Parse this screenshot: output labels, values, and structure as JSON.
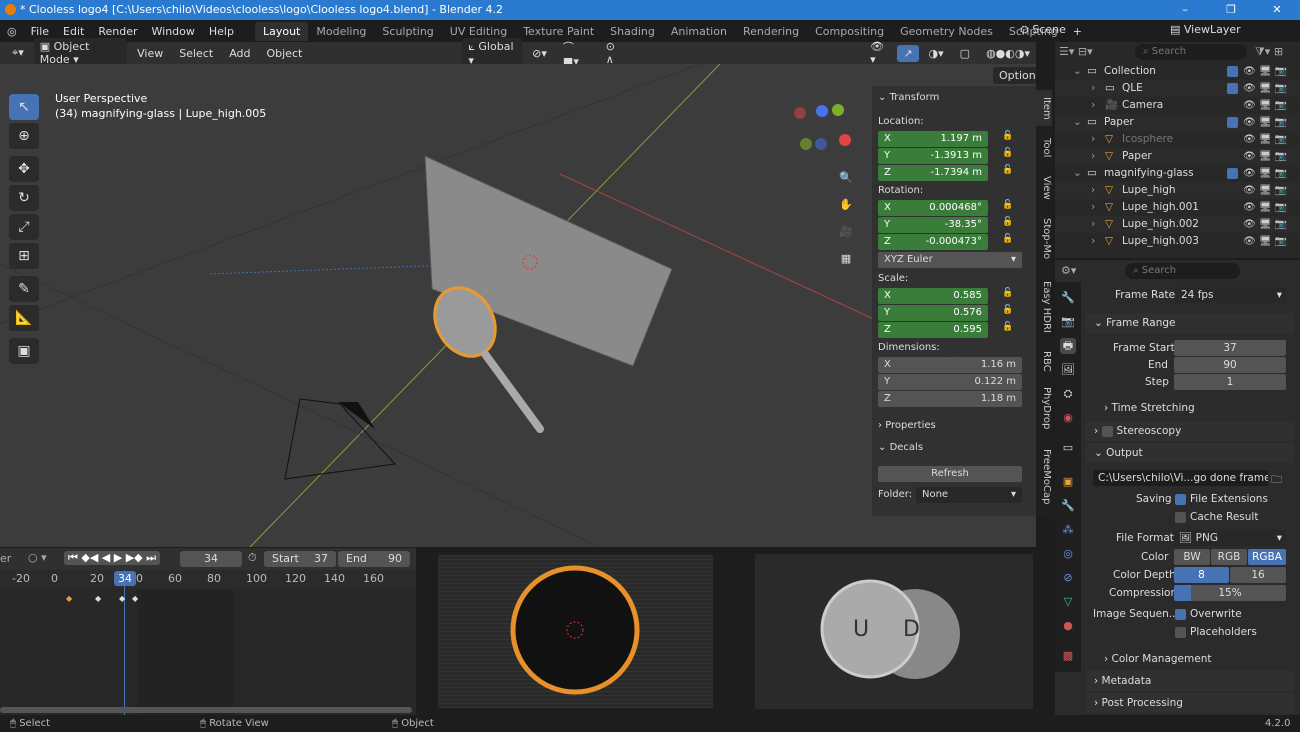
{
  "window": {
    "title": "* Clooless logo4 [C:\\Users\\chilo\\Videos\\clooless\\logo\\Clooless logo4.blend] - Blender 4.2"
  },
  "menu": [
    "File",
    "Edit",
    "Render",
    "Window",
    "Help"
  ],
  "workspaces": [
    "Layout",
    "Modeling",
    "Sculpting",
    "UV Editing",
    "Texture Paint",
    "Shading",
    "Animation",
    "Rendering",
    "Compositing",
    "Geometry Nodes",
    "Scripting"
  ],
  "scene": "Scene",
  "view_layer": "ViewLayer",
  "viewport_header": {
    "mode": "Object Mode",
    "menus": [
      "View",
      "Select",
      "Add",
      "Object"
    ],
    "orientation": "Global",
    "options": "Options"
  },
  "viewport": {
    "perspective": "User Perspective",
    "object_info": "(34) magnifying-glass | Lupe_high.005"
  },
  "npanel": {
    "transform": "Transform",
    "location_label": "Location:",
    "location": [
      {
        "axis": "X",
        "value": "1.197 m"
      },
      {
        "axis": "Y",
        "value": "-1.3913 m"
      },
      {
        "axis": "Z",
        "value": "-1.7394 m"
      }
    ],
    "rotation_label": "Rotation:",
    "rotation": [
      {
        "axis": "X",
        "value": "0.000468°"
      },
      {
        "axis": "Y",
        "value": "-38.35°"
      },
      {
        "axis": "Z",
        "value": "-0.000473°"
      }
    ],
    "rotation_mode": "XYZ Euler",
    "scale_label": "Scale:",
    "scale": [
      {
        "axis": "X",
        "value": "0.585"
      },
      {
        "axis": "Y",
        "value": "0.576"
      },
      {
        "axis": "Z",
        "value": "0.595"
      }
    ],
    "dimensions_label": "Dimensions:",
    "dimensions": [
      {
        "axis": "X",
        "value": "1.16 m"
      },
      {
        "axis": "Y",
        "value": "0.122 m"
      },
      {
        "axis": "Z",
        "value": "1.18 m"
      }
    ],
    "properties": "Properties",
    "decals": "Decals",
    "refresh": "Refresh",
    "folder_label": "Folder:",
    "folder": "None",
    "tabs": [
      "Item",
      "Tool",
      "View",
      "Stop-Mo",
      "Easy HDRI",
      "RBC",
      "PhyDrop",
      "FreeMoCap"
    ]
  },
  "outliner": {
    "search_placeholder": "Search",
    "rows": [
      {
        "name": "Collection",
        "indent": 0,
        "kind": "collection"
      },
      {
        "name": "QLE",
        "indent": 1,
        "kind": "collection"
      },
      {
        "name": "Camera",
        "indent": 1,
        "kind": "camera"
      },
      {
        "name": "Paper",
        "indent": 0,
        "kind": "collection"
      },
      {
        "name": "Icosphere",
        "indent": 1,
        "kind": "mesh",
        "dim": true
      },
      {
        "name": "Paper",
        "indent": 1,
        "kind": "mesh"
      },
      {
        "name": "magnifying-glass",
        "indent": 0,
        "kind": "collection"
      },
      {
        "name": "Lupe_high",
        "indent": 1,
        "kind": "mesh"
      },
      {
        "name": "Lupe_high.001",
        "indent": 1,
        "kind": "mesh"
      },
      {
        "name": "Lupe_high.002",
        "indent": 1,
        "kind": "mesh"
      },
      {
        "name": "Lupe_high.003",
        "indent": 1,
        "kind": "mesh"
      }
    ]
  },
  "properties": {
    "search_placeholder": "Search",
    "frame_rate_label": "Frame Rate",
    "frame_rate": "24 fps",
    "frame_range": "Frame Range",
    "frame_start_label": "Frame Start",
    "frame_start": "37",
    "end_label": "End",
    "end": "90",
    "step_label": "Step",
    "step": "1",
    "time_stretching": "Time Stretching",
    "stereoscopy": "Stereoscopy",
    "output": "Output",
    "output_path": "C:\\Users\\chilo\\Vi...go done frames 2\\",
    "saving_label": "Saving",
    "file_extensions": "File Extensions",
    "cache_result": "Cache Result",
    "file_format_label": "File Format",
    "file_format": "PNG",
    "color_label": "Color",
    "color_options": [
      "BW",
      "RGB",
      "RGBA"
    ],
    "color_selected": "RGBA",
    "color_depth_label": "Color Depth",
    "color_depth_options": [
      "8",
      "16"
    ],
    "color_depth_selected": "8",
    "compression_label": "Compression",
    "compression": "15%",
    "compression_value": 15,
    "image_sequence_label": "Image Sequen...",
    "overwrite": "Overwrite",
    "placeholders": "Placeholders",
    "color_management": "Color Management",
    "metadata": "Metadata",
    "post_processing": "Post Processing"
  },
  "timeline": {
    "current_frame": "34",
    "start_label": "Start",
    "start": "37",
    "end_label": "End",
    "end": "90",
    "ticks": [
      "-20",
      "0",
      "20",
      "40",
      "60",
      "80",
      "100",
      "120",
      "140",
      "160"
    ],
    "editor_label": "er"
  },
  "status": {
    "select": "Select",
    "rotate": "Rotate View",
    "object": "Object",
    "version": "4.2.0"
  },
  "colors": {
    "accent": "#4772b3",
    "selected_orange": "#e8a33a",
    "green_field": "#3a7d3a"
  }
}
